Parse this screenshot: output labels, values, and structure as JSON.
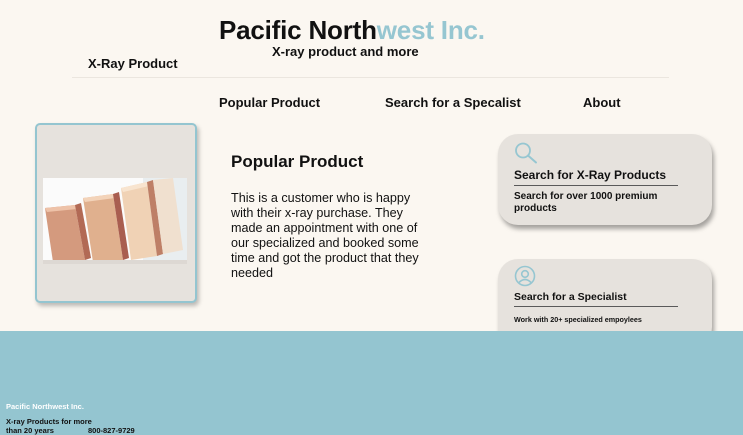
{
  "header": {
    "title_main": "Pacific North",
    "title_accent": "west Inc.",
    "subtitle": "X-ray product and more",
    "brand_label": "X-Ray Product"
  },
  "nav": {
    "items": [
      {
        "label": "Popular Product"
      },
      {
        "label": "Search for a Specalist"
      },
      {
        "label": "About"
      }
    ]
  },
  "main": {
    "section_title": "Popular Product",
    "section_body": "This is a customer who is happy with their x-ray purchase. They made an appointment with one of our specialized and booked some time and got the product that they needed"
  },
  "cards": [
    {
      "icon": "search-icon",
      "title": "Search for X-Ray Products",
      "description": "Search for over 1000 premium products"
    },
    {
      "icon": "user-icon",
      "title": "Search for a Specialist",
      "description": "Work with 20+ specialized empoylees"
    }
  ],
  "footer": {
    "company": "Pacific Northwest Inc.",
    "tagline": "X-ray Products for more than 20 years",
    "phone": "800-827-9729"
  },
  "colors": {
    "background": "#fbf7f1",
    "accent": "#96c6d1",
    "card": "#e6e2dd",
    "footer": "#94c5d0"
  }
}
